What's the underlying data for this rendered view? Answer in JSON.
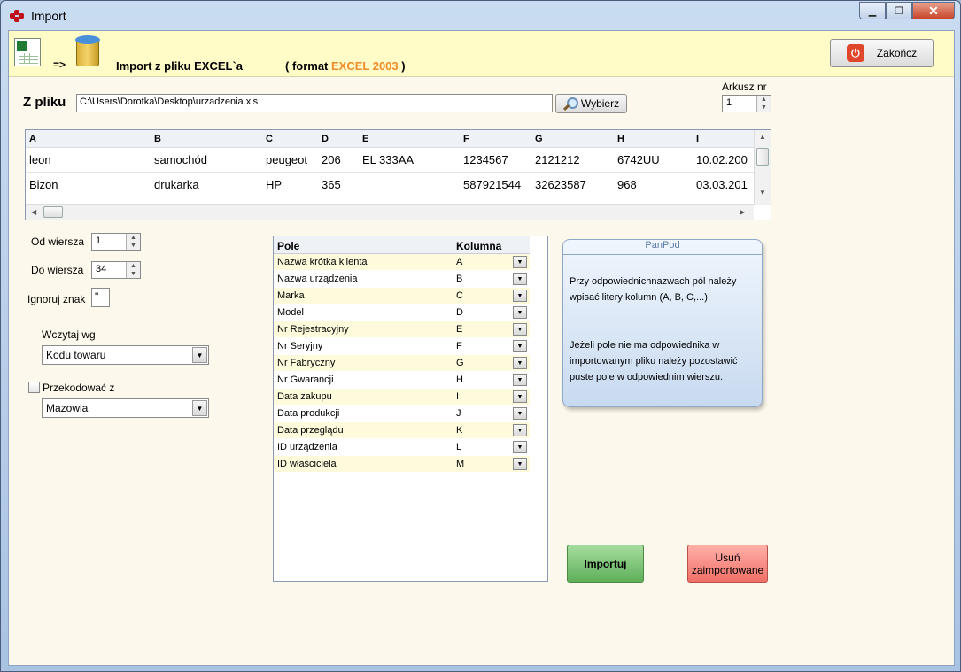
{
  "window": {
    "title": "Import"
  },
  "header": {
    "arrow": "=>",
    "title": "Import z pliku EXCEL`a",
    "format_prefix": "( format ",
    "format_value": "EXCEL 2003",
    "format_suffix": " )",
    "end_button": "Zakończ"
  },
  "file": {
    "label": "Z pliku",
    "path": "C:\\Users\\Dorotka\\Desktop\\urzadzenia.xls",
    "browse_button": "Wybierz",
    "sheet_label": "Arkusz nr",
    "sheet_value": "1"
  },
  "grid": {
    "columns": [
      "A",
      "B",
      "C",
      "D",
      "E",
      "F",
      "G",
      "H",
      "I"
    ],
    "rows": [
      [
        "leon",
        "samochód",
        "peugeot",
        "206",
        "EL 333AA",
        "1234567",
        "2121212",
        "6742UU",
        "10.02.200"
      ],
      [
        "Bizon",
        "drukarka",
        "HP",
        "365",
        "",
        "587921544",
        "32623587",
        "968",
        "03.03.201"
      ]
    ]
  },
  "options": {
    "from_row_label": "Od wiersza",
    "from_row_value": "1",
    "to_row_label": "Do wiersza",
    "to_row_value": "34",
    "ignore_char_label": "Ignoruj znak",
    "ignore_char_value": "\"",
    "load_by_label": "Wczytaj wg",
    "load_by_value": "Kodu towaru",
    "recode_label": "Przekodować z",
    "recode_value": "Mazowia"
  },
  "mapping": {
    "header_field": "Pole",
    "header_column": "Kolumna",
    "rows": [
      {
        "field": "Nazwa krótka klienta",
        "column": "A"
      },
      {
        "field": "Nazwa urządzenia",
        "column": "B"
      },
      {
        "field": "Marka",
        "column": "C"
      },
      {
        "field": "Model",
        "column": "D"
      },
      {
        "field": "Nr Rejestracyjny",
        "column": "E"
      },
      {
        "field": "Nr Seryjny",
        "column": "F"
      },
      {
        "field": "Nr Fabryczny",
        "column": "G"
      },
      {
        "field": "Nr Gwarancji",
        "column": "H"
      },
      {
        "field": "Data zakupu",
        "column": "I"
      },
      {
        "field": "Data produkcji",
        "column": "J"
      },
      {
        "field": "Data przeglądu",
        "column": "K"
      },
      {
        "field": "ID urządzenia",
        "column": "L"
      },
      {
        "field": "ID właściciela",
        "column": "M"
      }
    ]
  },
  "info": {
    "title": "PanPod",
    "p1": "Przy odpowiednichnazwach pól należy wpisać litery kolumn (A, B, C,...)",
    "p2": "Jeżeli pole nie ma odpowiednika w importowanym pliku należy   pozostawić puste pole w odpowiednim wierszu."
  },
  "actions": {
    "import_button": "Importuj",
    "delete_button_line1": "Usuń",
    "delete_button_line2": "zaimportowane"
  }
}
